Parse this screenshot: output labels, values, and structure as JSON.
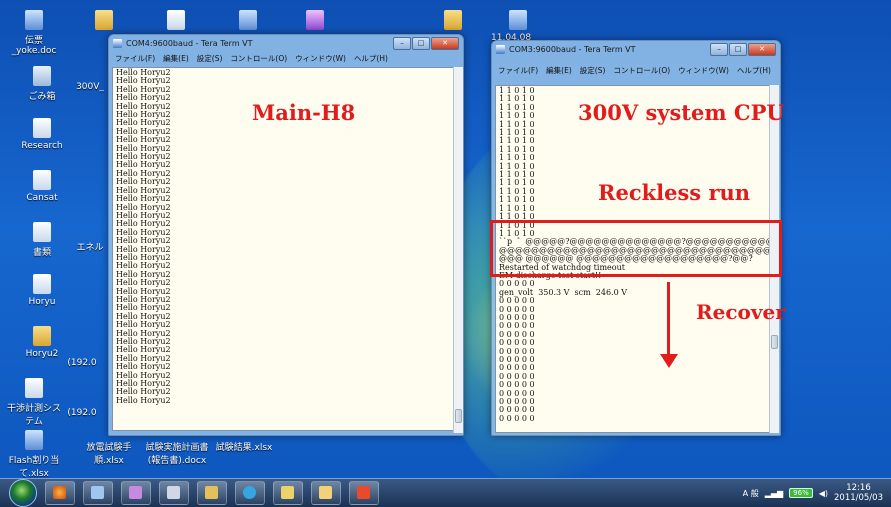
{
  "desktop": {
    "icons": [
      {
        "label": "伝票_yoke.doc"
      },
      {
        "label": "ごみ箱"
      },
      {
        "label": "Research"
      },
      {
        "label": "Cansat"
      },
      {
        "label": "書類"
      },
      {
        "label": "Horyu"
      },
      {
        "label": "Horyu2"
      },
      {
        "label": "干渉計測システム"
      },
      {
        "label": "Flash割り当て.xlsx"
      },
      {
        "label": "300V_"
      },
      {
        "label": "エネル"
      },
      {
        "label": "(192.0"
      },
      {
        "label": "(192.0"
      },
      {
        "label": "放電試験手順.xlsx"
      },
      {
        "label": "試験実施計画書(報告書).docx"
      },
      {
        "label": "試験結果.xlsx"
      }
    ],
    "top_right_label": "11.04.08"
  },
  "window_left": {
    "title": "COM4:9600baud - Tera Term VT",
    "menu": [
      "ファイル(F)",
      "編集(E)",
      "設定(S)",
      "コントロール(O)",
      "ウィンドウ(W)",
      "ヘルプ(H)"
    ],
    "lines": [
      "Hello Horyu2",
      "Hello Horyu2",
      "Hello Horyu2",
      "Hello Horyu2",
      "Hello Horyu2",
      "Hello Horyu2",
      "Hello Horyu2",
      "Hello Horyu2",
      "Hello Horyu2",
      "Hello Horyu2",
      "Hello Horyu2",
      "Hello Horyu2",
      "Hello Horyu2",
      "Hello Horyu2",
      "Hello Horyu2",
      "Hello Horyu2",
      "Hello Horyu2",
      "Hello Horyu2",
      "Hello Horyu2",
      "Hello Horyu2",
      "Hello Horyu2",
      "Hello Horyu2",
      "Hello Horyu2",
      "Hello Horyu2",
      "Hello Horyu2",
      "Hello Horyu2",
      "Hello Horyu2",
      "Hello Horyu2",
      "Hello Horyu2",
      "Hello Horyu2",
      "Hello Horyu2",
      "Hello Horyu2",
      "Hello Horyu2",
      "Hello Horyu2",
      "Hello Horyu2",
      "Hello Horyu2",
      "Hello Horyu2",
      "Hello Horyu2",
      "Hello Horyu2",
      "Hello Horyu2"
    ]
  },
  "window_right": {
    "title": "COM3:9600baud - Tera Term VT",
    "menu": [
      "ファイル(F)",
      "編集(E)",
      "設定(S)",
      "コントロール(O)",
      "ウィンドウ(W)",
      "ヘルプ(H)"
    ],
    "lines": [
      "1 1 0 1 0",
      "1 1 0 1 0",
      "1 1 0 1 0",
      "1 1 0 1 0",
      "1 1 0 1 0",
      "1 1 0 1 0",
      "1 1 0 1 0",
      "1 1 0 1 0",
      "1 1 0 1 0",
      "1 1 0 1 0",
      "1 1 0 1 0",
      "1 1 0 1 0",
      "1 1 0 1 0",
      "1 1 0 1 0",
      "1 1 0 1 0",
      "1 1 0 1 0",
      "1 1 0 1 0",
      "1 1 0 1 0",
      "``p  ゛@@@@@?@@@@@@@@@@@@@@?@@@@@@@@@@@@@@@@@@@@@@@@@@@@",
      "@@@@@@@@@@@@@@@@@@@@@@@@@@@@@@@@@@@@@@@@@?@@@@@@@@",
      "@@@ @@@@@@ @@@@@@@@@@@@@@@@@@@?@@?",
      "Restarted of watchdog timeout",
      "EM discharge test start!!",
      "0 0 0 0 0",
      "gen_volt  350.3 V  scm  246.0 V",
      "0 0 0 0 0",
      "0 0 0 0 0",
      "0 0 0 0 0",
      "0 0 0 0 0",
      "0 0 0 0 0",
      "0 0 0 0 0",
      "0 0 0 0 0",
      "0 0 0 0 0",
      "0 0 0 0 0",
      "0 0 0 0 0",
      "0 0 0 0 0",
      "0 0 0 0 0",
      "0 0 0 0 0",
      "0 0 0 0 0",
      "0 0 0 0 0"
    ]
  },
  "annotations": {
    "main_label": "Main-H8",
    "cpu_label": "300V system CPU",
    "reckless_label": "Reckless run",
    "recover_label": "Recover",
    "accent": "#e21b1b"
  },
  "taskbar": {
    "language": "A 般",
    "battery": "96%",
    "time": "12:16",
    "date": "2011/05/03"
  }
}
